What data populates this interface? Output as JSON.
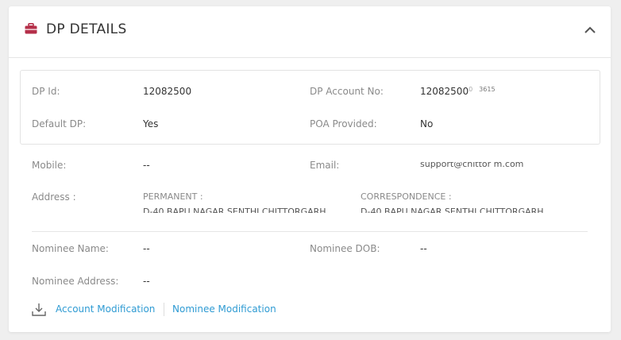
{
  "header": {
    "title": "DP DETAILS",
    "icon": "briefcase-icon",
    "collapse_icon": "chevron-up-icon",
    "accent": "#b5304a"
  },
  "dp": {
    "id_label": "DP Id:",
    "id_value": "12082500",
    "account_label": "DP Account No:",
    "account_value": "12082500",
    "account_value_tail": "0",
    "account_value_end": "3615",
    "default_label": "Default DP:",
    "default_value": "Yes",
    "poa_label": "POA Provided:",
    "poa_value": "No"
  },
  "contact": {
    "mobile_label": "Mobile:",
    "mobile_value": "--",
    "email_label": "Email:",
    "email_value": "support@chittor   m.com",
    "address_label": "Address :",
    "permanent_label": "PERMANENT :",
    "permanent_value": "D-40 BAPU NAGAR SENTHI CHITTORGARH",
    "correspondence_label": "CORRESPONDENCE :",
    "correspondence_value": "D-40 BAPU NAGAR SENTHI CHITTORGARH"
  },
  "nominee": {
    "name_label": "Nominee Name:",
    "name_value": "--",
    "dob_label": "Nominee DOB:",
    "dob_value": "--",
    "address_label": "Nominee Address:",
    "address_value": "--"
  },
  "actions": {
    "download_icon": "download-icon",
    "account_modification": "Account Modification",
    "nominee_modification": "Nominee Modification"
  }
}
